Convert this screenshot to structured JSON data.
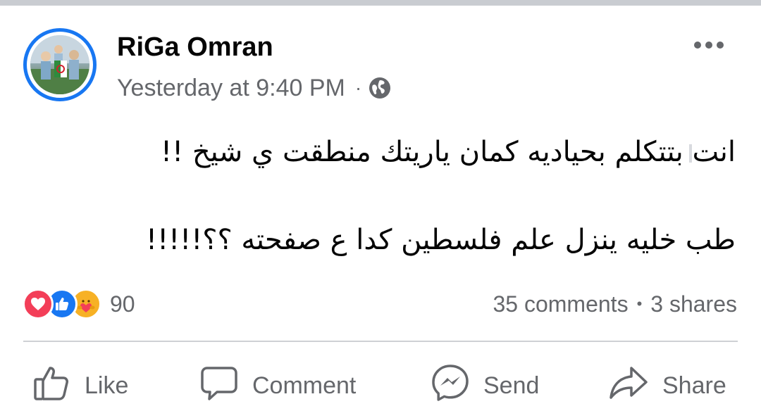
{
  "post": {
    "author": "RiGa Omran",
    "timestamp": "Yesterday at 9:40 PM",
    "meta_separator": "·",
    "privacy_icon": "globe-icon",
    "more_icon": "more-horizontal-icon",
    "text_line_1": "انت بتتكلم بحياديه كمان ياريتك منطقت ي شيخ !!",
    "text_line_2": "طب خليه ينزل علم فلسطين كدا ع صفحته ؟؟!!!!!"
  },
  "reactions": {
    "icons": [
      "love-reaction-icon",
      "like-reaction-icon",
      "care-reaction-icon"
    ],
    "count": "90"
  },
  "stats": {
    "comments": "35 comments",
    "separator": "•",
    "shares": "3 shares"
  },
  "actions": {
    "like": "Like",
    "comment": "Comment",
    "send": "Send",
    "share": "Share"
  },
  "colors": {
    "accent": "#1877f2",
    "secondary_text": "#65676b",
    "love": "#f33e58",
    "care": "#f7b125",
    "divider": "#ced0d4"
  }
}
